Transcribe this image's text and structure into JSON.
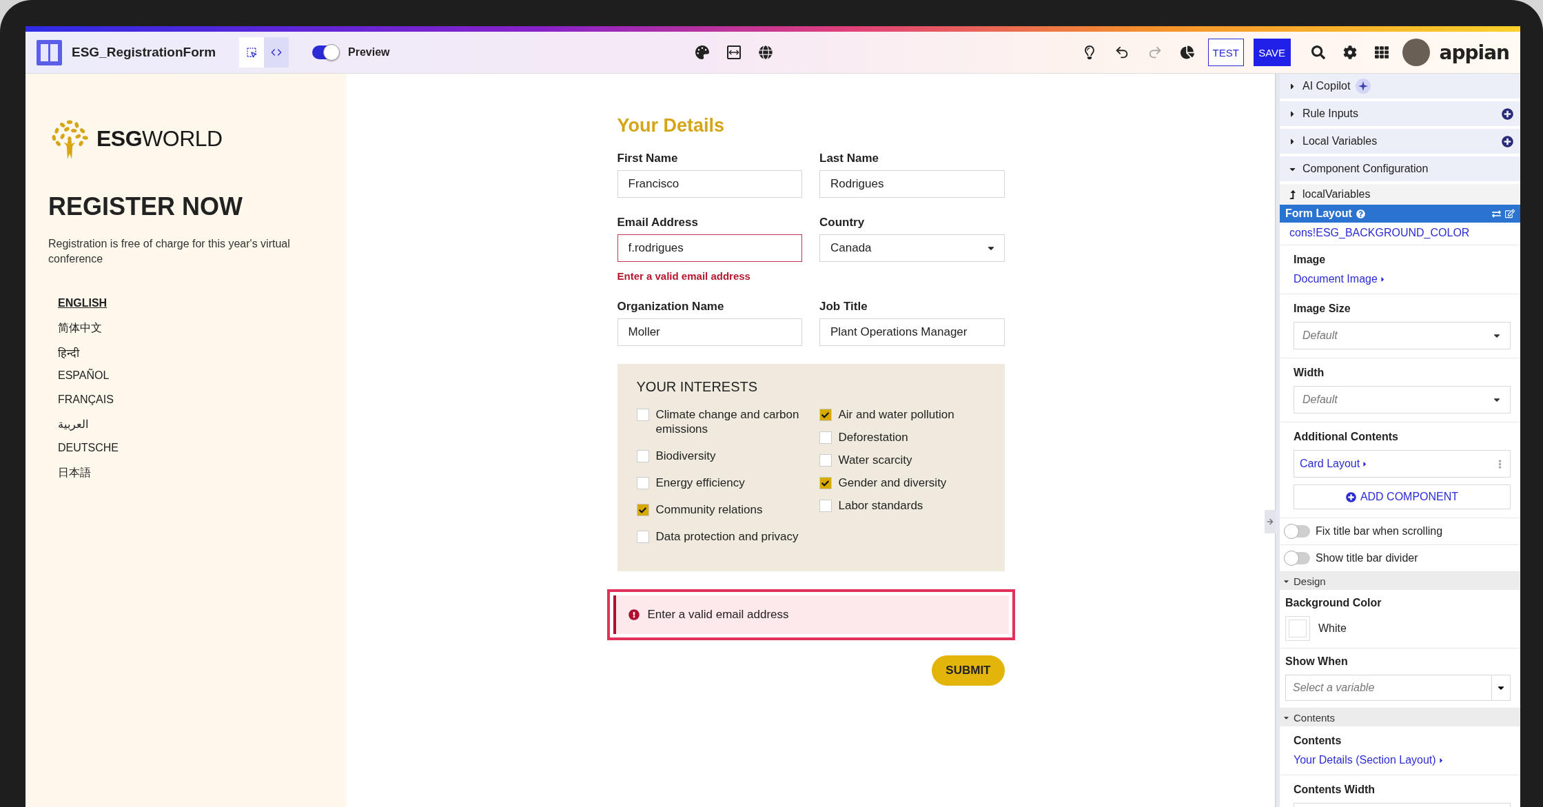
{
  "toolbar": {
    "title": "ESG_RegistrationForm",
    "view_modes": [
      {
        "kind": "design",
        "selected": true
      },
      {
        "kind": "code",
        "selected": false
      }
    ],
    "preview": {
      "label": "Preview",
      "on": true
    },
    "history": {
      "undo_disabled": false,
      "redo_disabled": true
    },
    "test_button": "TEST",
    "save_button": "SAVE",
    "brand": "appian"
  },
  "left_panel": {
    "logo": "**ESG**WORLD",
    "heading": "REGISTER NOW",
    "intro": "Registration is free of charge for this year's virtual conference",
    "languages": [
      {
        "label": "ENGLISH",
        "selected": true
      },
      {
        "label": "简体中文",
        "selected": false
      },
      {
        "label": "हिन्दी",
        "selected": false
      },
      {
        "label": "ESPAÑOL",
        "selected": false
      },
      {
        "label": "FRANÇAIS",
        "selected": false
      },
      {
        "label": "العربية",
        "selected": false
      },
      {
        "label": "DEUTSCHE",
        "selected": false
      },
      {
        "label": "日本語",
        "selected": false
      }
    ]
  },
  "form": {
    "title": "Your Details",
    "fields": [
      {
        "kind": "text",
        "label": "First Name",
        "value": "Francisco"
      },
      {
        "kind": "text",
        "label": "Last Name",
        "value": "Rodrigues"
      },
      {
        "kind": "text",
        "label": "Email Address",
        "value": "f.rodrigues",
        "error": "Enter a valid email address"
      },
      {
        "kind": "select",
        "label": "Country",
        "value": "Canada"
      },
      {
        "kind": "text",
        "label": "Organization Name",
        "value": "Moller"
      },
      {
        "kind": "text",
        "label": "Job Title",
        "value": "Plant Operations Manager"
      }
    ],
    "interests": {
      "title": "YOUR INTERESTS",
      "left": [
        {
          "label": "Climate change and carbon emissions",
          "checked": false
        },
        {
          "label": "Biodiversity",
          "checked": false
        },
        {
          "label": "Energy efficiency",
          "checked": false
        },
        {
          "label": "Community relations",
          "checked": true
        },
        {
          "label": "Data protection and privacy",
          "checked": false
        }
      ],
      "right": [
        {
          "label": "Air and water pollution",
          "checked": true
        },
        {
          "label": "Deforestation",
          "checked": false
        },
        {
          "label": "Water scarcity",
          "checked": false
        },
        {
          "label": "Gender and diversity",
          "checked": true
        },
        {
          "label": "Labor standards",
          "checked": false
        }
      ]
    },
    "error_banner": "Enter a valid email address",
    "submit": "SUBMIT"
  },
  "right_panel": {
    "sections": [
      {
        "kind": "copilot",
        "label": "AI Copilot",
        "expanded": false
      },
      {
        "kind": "add",
        "label": "Rule Inputs",
        "expanded": false
      },
      {
        "kind": "add",
        "label": "Local Variables",
        "expanded": false
      },
      {
        "kind": "plain",
        "label": "Component Configuration",
        "expanded": true
      }
    ],
    "breadcrumb": "localVariables",
    "component": "Form Layout",
    "constant": "cons!ESG_BACKGROUND_COLOR",
    "properties": [
      {
        "kind": "link",
        "label": "Image",
        "value": "Document Image"
      },
      {
        "kind": "select",
        "label": "Image Size",
        "placeholder": "Default"
      },
      {
        "kind": "select",
        "label": "Width",
        "placeholder": "Default"
      },
      {
        "kind": "list",
        "label": "Additional Contents",
        "items": [
          "Card Layout"
        ],
        "add_label": "ADD COMPONENT"
      },
      {
        "kind": "toggle",
        "label": "Fix title bar when scrolling",
        "on": false
      },
      {
        "kind": "toggle",
        "label": "Show title bar divider",
        "on": false
      },
      {
        "kind": "group",
        "label": "Design",
        "expanded": true
      },
      {
        "kind": "color",
        "label": "Background Color",
        "value": "White"
      },
      {
        "kind": "combo",
        "label": "Show When",
        "placeholder": "Select a variable"
      },
      {
        "kind": "group",
        "label": "Contents",
        "expanded": true
      },
      {
        "kind": "link",
        "label": "Contents",
        "value": "Your Details (Section Layout)"
      },
      {
        "kind": "select",
        "label": "Contents Width"
      }
    ]
  }
}
